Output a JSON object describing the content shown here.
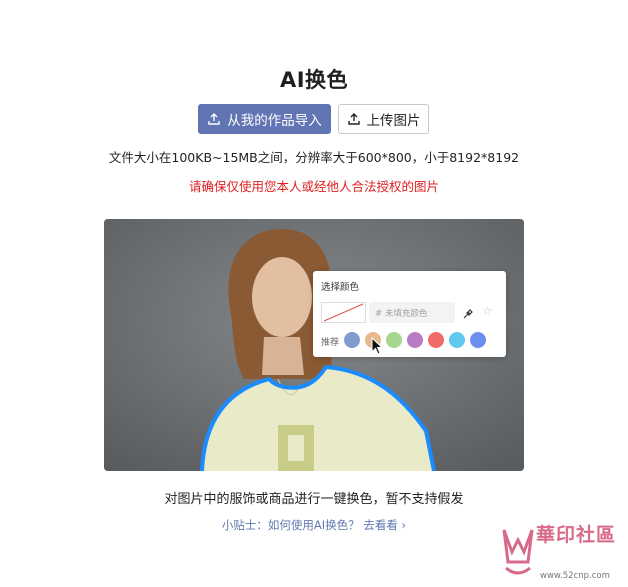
{
  "page": {
    "title": "AI换色",
    "import_button": "从我的作品导入",
    "upload_button": "上传图片",
    "file_note": "文件大小在100KB~15MB之间，分辨率大于600*800，小于8192*8192",
    "warning": "请确保仅使用您本人或经他人合法授权的图片",
    "caption": "对图片中的服饰或商品进行一键换色，暂不支持假发",
    "tip": "小贴士：如何使用AI换色？ 去看看 ›",
    "accent_color": "#6174b3",
    "warning_color": "#e02020",
    "tip_color": "#6178b0"
  },
  "preview": {
    "outline_color": "#1a8cff",
    "shirt_color": "#e8eac8",
    "print_color": "#c9cc86"
  },
  "picker": {
    "title": "选择颜色",
    "hex_placeholder": "#  未填充颜色",
    "recommend_label": "推荐",
    "eyedropper_icon": "eyedropper-icon",
    "star_icon": "star-icon",
    "swatches": [
      "#7f9ccc",
      "#e8b98c",
      "#a6d68f",
      "#b87ac7",
      "#f06a6a",
      "#5ec8ef",
      "#6a8ff0"
    ]
  },
  "watermark": {
    "text": "華印社區",
    "url": "www.52cnp.com"
  }
}
